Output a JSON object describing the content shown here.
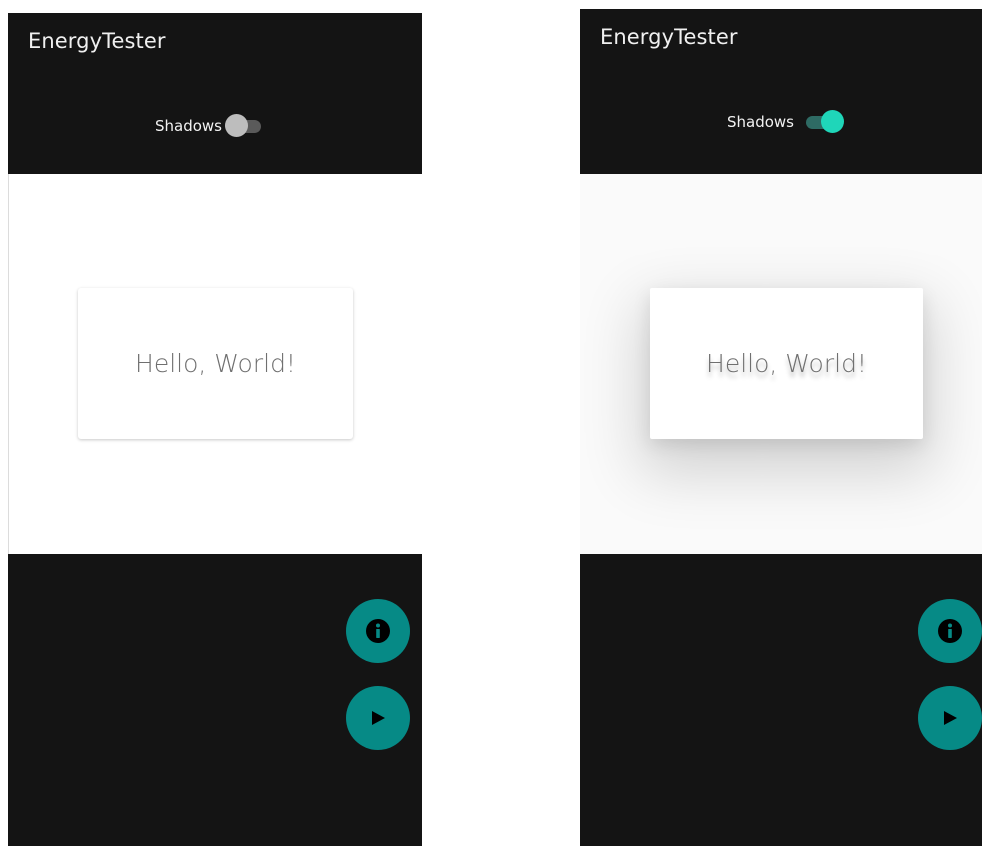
{
  "screens": [
    {
      "app_title": "EnergyTester",
      "toggle_label": "Shadows",
      "shadows_enabled": false,
      "card_text": "Hello, World!",
      "fab_info_icon": "info-icon",
      "fab_play_icon": "play-icon"
    },
    {
      "app_title": "EnergyTester",
      "toggle_label": "Shadows",
      "shadows_enabled": true,
      "card_text": "Hello, World!",
      "fab_info_icon": "info-icon",
      "fab_play_icon": "play-icon"
    }
  ],
  "colors": {
    "toolbar_bg": "#141414",
    "fab_bg": "#068a86",
    "switch_on_thumb": "#1fd6b9",
    "switch_off_thumb": "#bdbdbd",
    "card_text": "#6f6f6f"
  }
}
